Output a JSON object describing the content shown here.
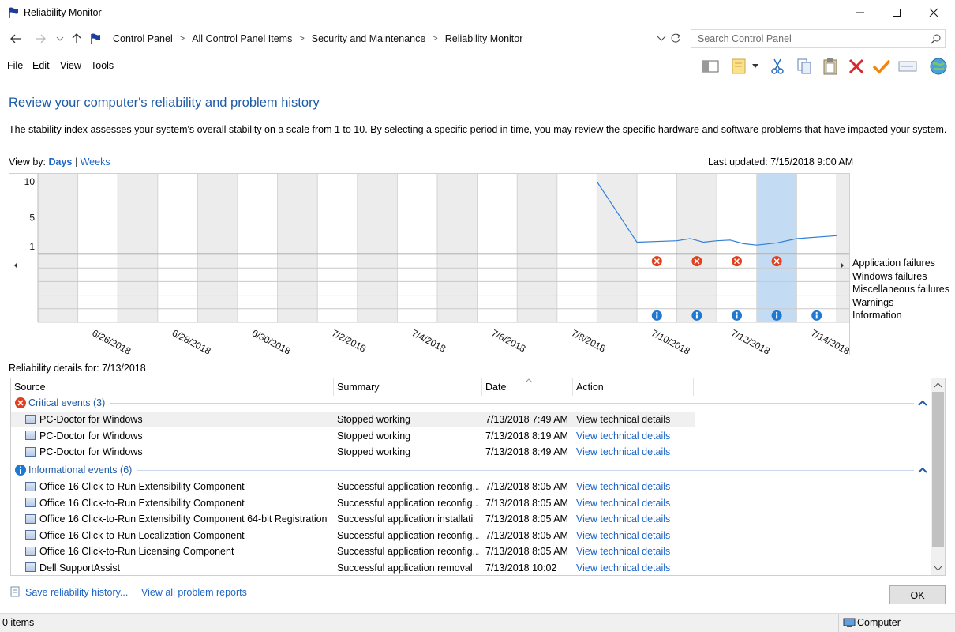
{
  "window": {
    "title": "Reliability Monitor"
  },
  "address": {
    "crumbs": [
      "Control Panel",
      "All Control Panel Items",
      "Security and Maintenance",
      "Reliability Monitor"
    ],
    "search_placeholder": "Search Control Panel"
  },
  "menu": {
    "file": "File",
    "edit": "Edit",
    "view": "View",
    "tools": "Tools"
  },
  "page": {
    "heading": "Review your computer's reliability and problem history",
    "description": "The stability index assesses your system's overall stability on a scale from 1 to 10. By selecting a specific period in time, you may review the specific hardware and software problems that have impacted your system.",
    "view_by_label": "View by:",
    "view_days": "Days",
    "view_sep": "|",
    "view_weeks": "Weeks",
    "last_updated": "Last updated: 7/15/2018 9:00 AM"
  },
  "chart_data": {
    "type": "line",
    "title": "",
    "y_ticks": [
      "10",
      "5",
      "1"
    ],
    "ylim": [
      1,
      10
    ],
    "columns": [
      "6/25/2018",
      "6/26/2018",
      "6/27/2018",
      "6/28/2018",
      "6/29/2018",
      "6/30/2018",
      "7/1/2018",
      "7/2/2018",
      "7/3/2018",
      "7/4/2018",
      "7/5/2018",
      "7/6/2018",
      "7/7/2018",
      "7/8/2018",
      "7/9/2018",
      "7/10/2018",
      "7/11/2018",
      "7/12/2018",
      "7/13/2018",
      "7/14/2018",
      "7/15/2018"
    ],
    "x_tick_labels": [
      "6/26/2018",
      "6/28/2018",
      "6/30/2018",
      "7/2/2018",
      "7/4/2018",
      "7/6/2018",
      "7/8/2018",
      "7/10/2018",
      "7/12/2018",
      "7/14/2018"
    ],
    "selected_column": "7/13/2018",
    "stability_index": [
      {
        "x": "7/9/2018",
        "y": 10.0
      },
      {
        "x": "7/10/2018",
        "y": 1.6
      },
      {
        "x": "7/11/2018",
        "y": 1.8
      },
      {
        "x": "7/11/2018",
        "y": 2.1
      },
      {
        "x": "7/11/2018",
        "y": 1.6
      },
      {
        "x": "7/12/2018",
        "y": 1.8
      },
      {
        "x": "7/12/2018",
        "y": 1.9
      },
      {
        "x": "7/12/2018",
        "y": 1.4
      },
      {
        "x": "7/13/2018",
        "y": 1.2
      },
      {
        "x": "7/13/2018",
        "y": 1.5
      },
      {
        "x": "7/14/2018",
        "y": 2.1
      },
      {
        "x": "7/15/2018",
        "y": 2.5
      }
    ],
    "rows": [
      "Application failures",
      "Windows failures",
      "Miscellaneous failures",
      "Warnings",
      "Information"
    ],
    "application_failures": [
      "7/10/2018",
      "7/11/2018",
      "7/12/2018",
      "7/13/2018"
    ],
    "information": [
      "7/10/2018",
      "7/11/2018",
      "7/12/2018",
      "7/13/2018",
      "7/14/2018"
    ]
  },
  "details": {
    "label": "Reliability details for: 7/13/2018",
    "headers": {
      "source": "Source",
      "summary": "Summary",
      "date": "Date",
      "action": "Action"
    },
    "critical_group": "Critical events (3)",
    "info_group": "Informational events (6)",
    "critical_rows": [
      {
        "source": "PC-Doctor for Windows",
        "summary": "Stopped working",
        "date": "7/13/2018 7:49 AM",
        "action": "View  technical details"
      },
      {
        "source": "PC-Doctor for Windows",
        "summary": "Stopped working",
        "date": "7/13/2018 8:19 AM",
        "action": "View  technical details"
      },
      {
        "source": "PC-Doctor for Windows",
        "summary": "Stopped working",
        "date": "7/13/2018 8:49 AM",
        "action": "View  technical details"
      }
    ],
    "info_rows": [
      {
        "source": "Office 16 Click-to-Run Extensibility Component",
        "summary": "Successful application reconfig...",
        "date": "7/13/2018 8:05 AM",
        "action": "View  technical details"
      },
      {
        "source": "Office 16 Click-to-Run Extensibility Component",
        "summary": "Successful application reconfig...",
        "date": "7/13/2018 8:05 AM",
        "action": "View  technical details"
      },
      {
        "source": "Office 16 Click-to-Run Extensibility Component 64-bit Registration",
        "summary": "Successful application installati",
        "date": "7/13/2018 8:05 AM",
        "action": "View  technical details"
      },
      {
        "source": "Office 16 Click-to-Run Localization Component",
        "summary": "Successful application reconfig...",
        "date": "7/13/2018 8:05 AM",
        "action": "View  technical details"
      },
      {
        "source": "Office 16 Click-to-Run Licensing Component",
        "summary": "Successful application reconfig...",
        "date": "7/13/2018 8:05 AM",
        "action": "View  technical details"
      },
      {
        "source": "Dell SupportAssist",
        "summary": "Successful application removal",
        "date": "7/13/2018 10:02",
        "action": "View  technical details"
      }
    ]
  },
  "footer": {
    "save_link": "Save reliability history...",
    "view_all_link": "View all problem reports",
    "ok": "OK"
  },
  "status": {
    "items": "0 items",
    "zone": "Computer"
  },
  "colors": {
    "link": "#1e66c8",
    "heading": "#1e5aa6",
    "selected_column": "#c4dcf3",
    "line": "#2f7fd8",
    "error": "#e0401f",
    "info": "#1f78d1"
  }
}
